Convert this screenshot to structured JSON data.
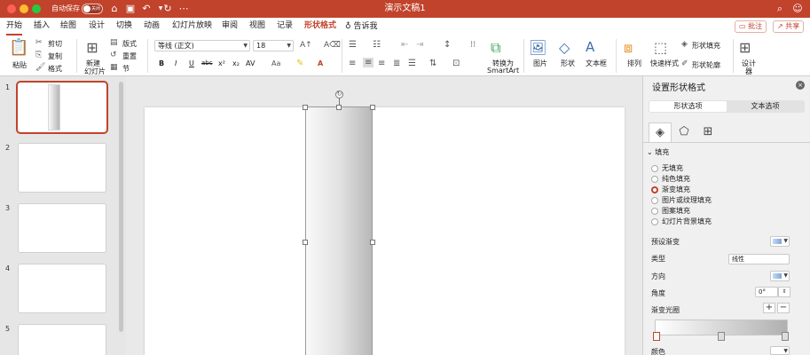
{
  "window": {
    "title": "演示文稿1",
    "autosave_label": "自动保存",
    "autosave_state": "关闭"
  },
  "tabs": [
    {
      "label": "开始",
      "active": true
    },
    {
      "label": "插入"
    },
    {
      "label": "绘图"
    },
    {
      "label": "设计"
    },
    {
      "label": "切换"
    },
    {
      "label": "动画"
    },
    {
      "label": "幻灯片放映"
    },
    {
      "label": "审阅"
    },
    {
      "label": "视图"
    },
    {
      "label": "记录"
    },
    {
      "label": "形状格式",
      "contextual": true
    }
  ],
  "tell_me": "告诉我",
  "comment_button": "批注",
  "share_button": "共享",
  "ribbon": {
    "paste": "粘贴",
    "cut": "剪切",
    "copy": "复制",
    "format": "格式",
    "new_slide": "新建\n幻灯片",
    "new_slide_line1": "新建",
    "new_slide_line2": "幻灯片",
    "layout": "版式",
    "reset": "重置",
    "section": "节",
    "font_name": "等线 (正文)",
    "font_size": "18",
    "bold": "B",
    "italic": "I",
    "underline": "U",
    "strike": "abc",
    "superscript": "x²",
    "subscript": "x₂",
    "char_spacing": "AV",
    "font_color": "A",
    "convert_smartart_line1": "转换为",
    "convert_smartart_line2": "SmartArt",
    "picture": "图片",
    "shape": "形状",
    "textbox": "文本框",
    "arrange": "排列",
    "quick_styles": "快速样式",
    "shape_fill": "形状填充",
    "shape_outline": "形状轮廓",
    "designer_line1": "设计",
    "designer_line2": "器"
  },
  "slides": [
    {
      "number": "1",
      "selected": true
    },
    {
      "number": "2"
    },
    {
      "number": "3"
    },
    {
      "number": "4"
    },
    {
      "number": "5"
    }
  ],
  "format_pane": {
    "title": "设置形状格式",
    "tab_shape": "形状选项",
    "tab_text": "文本选项",
    "fill_section": "填充",
    "fill_options": [
      {
        "label": "无填充"
      },
      {
        "label": "纯色填充"
      },
      {
        "label": "渐变填充",
        "selected": true
      },
      {
        "label": "图片或纹理填充"
      },
      {
        "label": "图案填充"
      },
      {
        "label": "幻灯片背景填充"
      }
    ],
    "preset_gradient": "预设渐变",
    "type_label": "类型",
    "type_value": "线性",
    "direction_label": "方向",
    "angle_label": "角度",
    "angle_value": "0°",
    "gradient_stops": "渐变光圈",
    "color_label": "颜色"
  },
  "colors": {
    "accent": "#c1432c"
  }
}
